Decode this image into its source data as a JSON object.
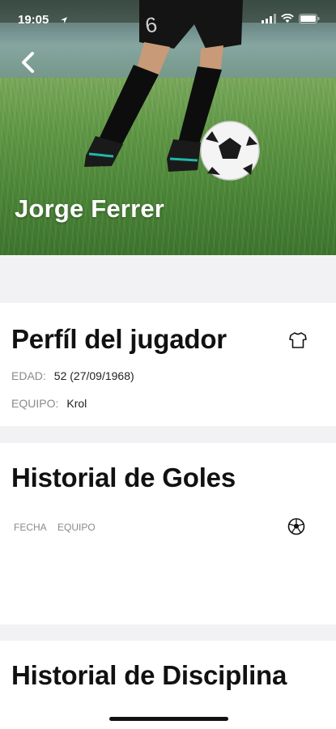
{
  "status": {
    "time": "19:05"
  },
  "hero": {
    "player_name": "Jorge Ferrer"
  },
  "profile": {
    "title": "Perfíl del jugador",
    "age_label": "EDAD:",
    "age_value": "52 (27/09/1968)",
    "team_label": "EQUIPO:",
    "team_value": "Krol"
  },
  "goals": {
    "title": "Historial de Goles",
    "columns": [
      "FECHA",
      "EQUIPO"
    ]
  },
  "discipline": {
    "title": "Historial de Disciplina"
  },
  "icons": {
    "back": "chevron-left-icon",
    "shirt": "shirt-icon",
    "ball": "soccer-ball-icon",
    "location": "location-arrow-icon",
    "signal": "cellular-signal-icon",
    "wifi": "wifi-icon",
    "battery": "battery-icon"
  },
  "colors": {
    "text": "#111111",
    "muted": "#8a8a8e",
    "background": "#f2f2f4"
  }
}
